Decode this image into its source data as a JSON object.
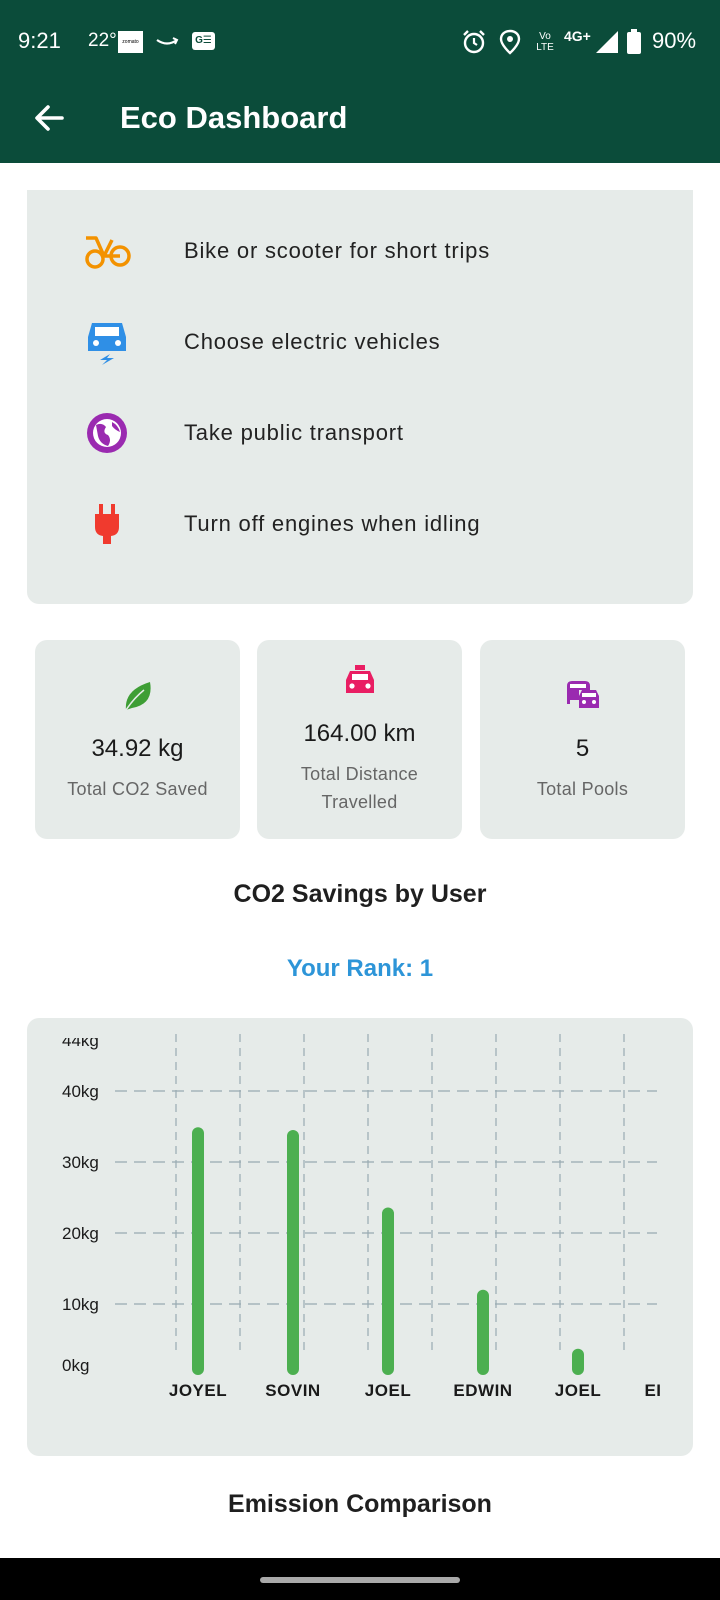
{
  "status_bar": {
    "time": "9:21",
    "temperature": "22°",
    "app_badge": "zomato",
    "battery": "90%",
    "network": "4G+",
    "volte": "Vo LTE"
  },
  "app_bar": {
    "title": "Eco Dashboard"
  },
  "tips": [
    {
      "label": "Bike or scooter for short trips",
      "icon": "bicycle-icon",
      "color": "#f39200"
    },
    {
      "label": "Choose electric vehicles",
      "icon": "electric-car-icon",
      "color": "#2f8fe6"
    },
    {
      "label": "Take public transport",
      "icon": "globe-icon",
      "color": "#9a2ab0"
    },
    {
      "label": "Turn off engines when idling",
      "icon": "plug-icon",
      "color": "#f03a2e"
    }
  ],
  "stats": [
    {
      "value": "34.92 kg",
      "label": "Total CO2 Saved",
      "icon": "leaf-icon",
      "color": "#3e9e35"
    },
    {
      "value": "164.00 km",
      "label": "Total Distance Travelled",
      "icon": "taxi-icon",
      "color": "#e91e63"
    },
    {
      "value": "5",
      "label": "Total Pools",
      "icon": "carpool-icon",
      "color": "#9a2ab0"
    }
  ],
  "sections": {
    "co2_title": "CO2 Savings by User",
    "rank": "Your Rank: 1",
    "emission_title": "Emission Comparison"
  },
  "chart_data": {
    "type": "bar",
    "categories": [
      "JOYEL",
      "SOVIN",
      "JOEL",
      "EDWIN",
      "JOEL",
      "EI"
    ],
    "values": [
      34.9,
      34.5,
      23.6,
      12.0,
      3.7,
      null
    ],
    "yticks": [
      "0kg",
      "10kg",
      "20kg",
      "30kg",
      "40kg",
      "44kg"
    ],
    "ylim": [
      0,
      44
    ],
    "bar_color": "#4caf50",
    "grid": true
  }
}
